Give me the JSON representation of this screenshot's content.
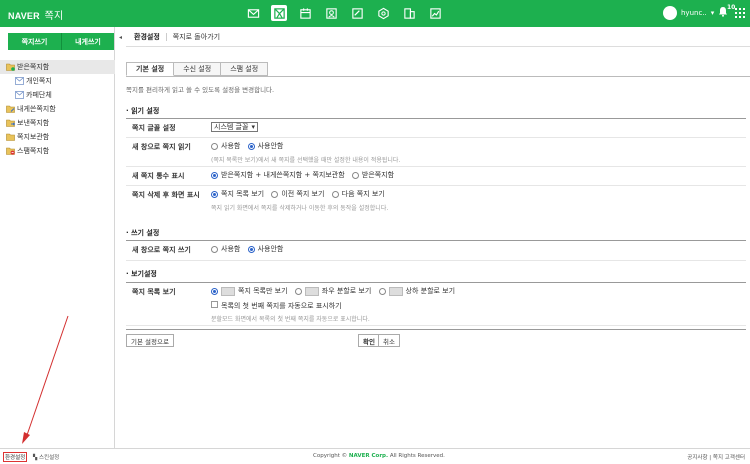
{
  "brand": {
    "name": "NAVER",
    "app": "쪽지"
  },
  "colors": {
    "brand": "#1db04f",
    "accent_radio": "#2a62c9",
    "annotation": "#d32f2f"
  },
  "top_apps": [
    "mail-icon",
    "note-icon",
    "calendar-icon",
    "contacts-icon",
    "memo-icon",
    "cloud-icon",
    "file-icon",
    "chart-icon"
  ],
  "user": {
    "name": "hyunc..",
    "bell_count": "10"
  },
  "sidebar": {
    "compose_label": "쪽지쓰기",
    "self_label": "내게쓰기",
    "folders": [
      {
        "label": "받은쪽지함"
      },
      {
        "label": "개인쪽지"
      },
      {
        "label": "카페단체"
      },
      {
        "label": "내게쓴쪽지함"
      },
      {
        "label": "보낸쪽지함"
      },
      {
        "label": "쪽지보관함"
      },
      {
        "label": "스팸쪽지함"
      }
    ]
  },
  "breadcrumb": {
    "current": "환경설정",
    "back": "쪽지로 돌아가기"
  },
  "tabs": [
    "기본 설정",
    "수신 설정",
    "스팸 설정"
  ],
  "intro": "쪽지를 편리하게 읽고 쓸 수 있도록 설정을 변경합니다.",
  "read": {
    "title": "읽기 설정",
    "font_label": "쪽지 글꼴 설정",
    "font_value": "시스템 글꼴",
    "newwin_label": "새 창으로 쪽지 읽기",
    "newwin_opt1": "사용함",
    "newwin_opt2": "사용안함",
    "newwin_desc": "(쪽지 목록만 보기)에서 새 쪽지를 선택했을 때만 설정한 내용이 적용됩니다.",
    "count_label": "새 쪽지 통수 표시",
    "count_opt1": "받은쪽지함 + 내게쓴쪽지함 + 쪽지보관함",
    "count_opt2": "받은쪽지함",
    "after_del_label": "쪽지 삭제 후 화면 표시",
    "after_opt1": "쪽지 목록 보기",
    "after_opt2": "이전 쪽지 보기",
    "after_opt3": "다음 쪽지 보기",
    "after_desc": "쪽지 읽기 화면에서 쪽지를 삭제하거나 이동한 후의 동작을 설정합니다."
  },
  "write": {
    "title": "쓰기 설정",
    "newwin_label": "새 창으로 쪽지 쓰기",
    "opt1": "사용함",
    "opt2": "사용안함"
  },
  "view": {
    "title": "보기설정",
    "list_label": "쪽지 목록 보기",
    "opt1": "쪽지 목록만 보기",
    "opt2": "좌우 분할로 보기",
    "opt3": "상하 분할로 보기",
    "check_label": "목록의 첫 번째 쪽지를 자동으로 표시하기",
    "desc": "분할모드 화면에서 목록의 첫 번째 쪽지를 자동으로 표시합니다."
  },
  "buttons": {
    "default": "기본 설정으로",
    "ok": "확인",
    "cancel": "취소"
  },
  "footer": {
    "env": "환경설정",
    "skin": "스킨설정",
    "copy_prefix": "Copyright ©",
    "copy_brand": "NAVER Corp.",
    "copy_suffix": "All Rights Reserved.",
    "notice": "공지사항",
    "help": "쪽지 고객센터"
  }
}
